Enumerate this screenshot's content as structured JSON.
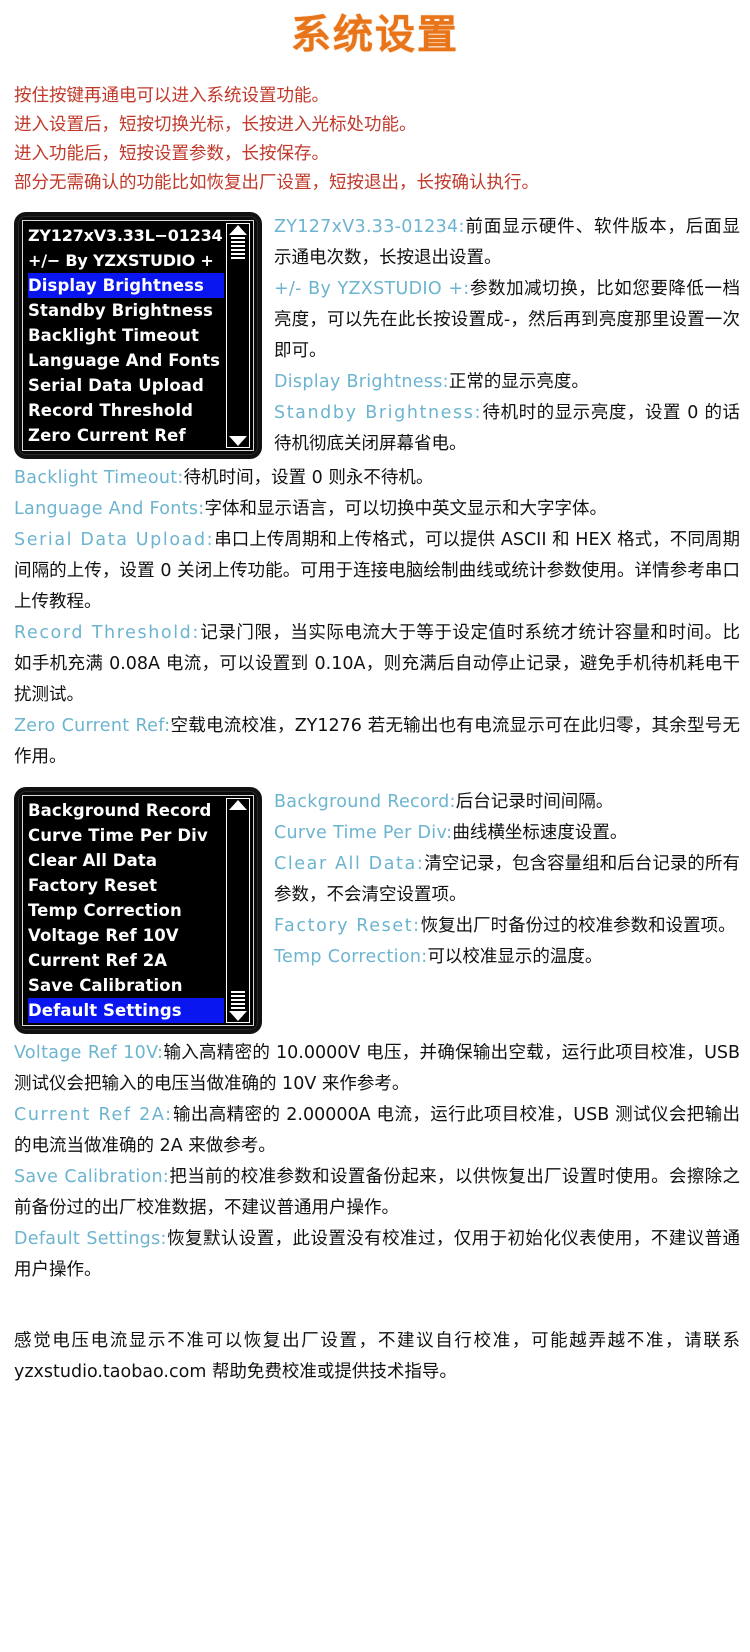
{
  "title": "系统设置",
  "intro": [
    "按住按键再通电可以进入系统设置功能。",
    "进入设置后，短按切换光标，长按进入光标处功能。",
    "进入功能后，短按设置参数，长按保存。",
    "部分无需确认的功能比如恢复出厂设置，短按退出，长按确认执行。"
  ],
  "lcd_panel_1": {
    "rows": [
      {
        "label": "ZY127xV3.33L−01234",
        "selected": false,
        "header": true
      },
      {
        "label": "+/−  By YZXSTUDIO +",
        "selected": false,
        "header": true
      },
      {
        "label": "Display Brightness",
        "selected": true,
        "header": false
      },
      {
        "label": "Standby Brightness",
        "selected": false,
        "header": false
      },
      {
        "label": "Backlight Timeout",
        "selected": false,
        "header": false
      },
      {
        "label": "Language And Fonts",
        "selected": false,
        "header": false
      },
      {
        "label": "Serial Data Upload",
        "selected": false,
        "header": false
      },
      {
        "label": "Record Threshold",
        "selected": false,
        "header": false
      },
      {
        "label": "Zero Current Ref",
        "selected": false,
        "header": false
      }
    ],
    "scrollbar": {
      "up_icon": "triangle-up-icon",
      "down_icon": "triangle-down-icon"
    }
  },
  "lcd_panel_2": {
    "rows": [
      {
        "label": "Background Record",
        "selected": false
      },
      {
        "label": "Curve Time Per Div",
        "selected": false
      },
      {
        "label": "Clear All Data",
        "selected": false
      },
      {
        "label": "Factory Reset",
        "selected": false
      },
      {
        "label": "Temp Correction",
        "selected": false
      },
      {
        "label": "Voltage Ref 10V",
        "selected": false
      },
      {
        "label": "Current Ref 2A",
        "selected": false
      },
      {
        "label": "Save Calibration",
        "selected": false
      },
      {
        "label": "Default Settings",
        "selected": true
      }
    ],
    "scrollbar": {
      "up_icon": "triangle-up-icon",
      "down_icon": "triangle-down-icon"
    }
  },
  "section1": [
    {
      "term": "ZY127xV3.33-01234:",
      "desc": "前面显示硬件、软件版本，后面显示通电次数，长按退出设置。"
    },
    {
      "term": "+/- By YZXSTUDIO +:",
      "desc": "参数加减切换，比如您要降低一档亮度，可以先在此长按设置成-，然后再到亮度那里设置一次即可。"
    },
    {
      "term": "Display Brightness:",
      "desc": "正常的显示亮度。"
    },
    {
      "term": "Standby  Brightness:",
      "desc": "待机时的显示亮度，设置 0 的话待机彻底关闭屏幕省电。"
    }
  ],
  "section2": [
    {
      "term": "Backlight Timeout:",
      "desc": "待机时间，设置 0 则永不待机。"
    },
    {
      "term": "Language And Fonts:",
      "desc": "字体和显示语言，可以切换中英文显示和大字字体。"
    },
    {
      "term": "Serial  Data  Upload:",
      "desc": "串口上传周期和上传格式，可以提供 ASCII 和 HEX 格式，不同周期间隔的上传，设置 0 关闭上传功能。可用于连接电脑绘制曲线或统计参数使用。详情参考串口上传教程。"
    },
    {
      "term": "Record Threshold:",
      "desc": "记录门限，当实际电流大于等于设定值时系统才统计容量和时间。比如手机充满 0.08A 电流，可以设置到 0.10A，则充满后自动停止记录，避免手机待机耗电干扰测试。"
    },
    {
      "term": "Zero Current Ref:",
      "desc": "空载电流校准，ZY1276 若无输出也有电流显示可在此归零，其余型号无作用。"
    }
  ],
  "section3": [
    {
      "term": "Background Record:",
      "desc": "后台记录时间间隔。"
    },
    {
      "term": "Curve Time Per Div:",
      "desc": "曲线横坐标速度设置。"
    },
    {
      "term": "Clear  All  Data:",
      "desc": "清空记录，包含容量组和后台记录的所有参数，不会清空设置项。"
    },
    {
      "term": "Factory  Reset:",
      "desc": "恢复出厂时备份过的校准参数和设置项。"
    },
    {
      "term": "Temp Correction:",
      "desc": "可以校准显示的温度。"
    }
  ],
  "section4": [
    {
      "term": "Voltage Ref 10V:",
      "desc": "输入高精密的 10.0000V 电压，并确保输出空载，运行此项目校准，USB 测试仪会把输入的电压当做准确的 10V 来作参考。"
    },
    {
      "term": "Current  Ref  2A:",
      "desc": "输出高精密的 2.00000A 电流，运行此项目校准，USB 测试仪会把输出的电流当做准确的 2A 来做参考。"
    },
    {
      "term": "Save Calibration:",
      "desc": "把当前的校准参数和设置备份起来，以供恢复出厂设置时使用。会擦除之前备份过的出厂校准数据，不建议普通用户操作。"
    },
    {
      "term": "Default Settings:",
      "desc": "恢复默认设置，此设置没有校准过，仅用于初始化仪表使用，不建议普通用户操作。"
    }
  ],
  "footer": "感觉电压电流显示不准可以恢复出厂设置，不建议自行校准，可能越弄越不准，请联系 yzxstudio.taobao.com 帮助免费校准或提供技术指导。"
}
